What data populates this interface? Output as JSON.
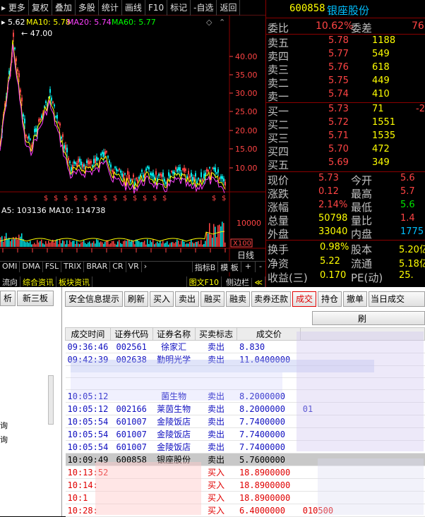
{
  "toolbar": {
    "items": [
      "更多",
      "复权",
      "叠加",
      "多股",
      "统计",
      "画线",
      "F10",
      "标记",
      "-自选",
      "返回"
    ]
  },
  "ma_line": {
    "ma5": "5.62",
    "ma10": "MA10: 5.78",
    "ma20": "MA20: 5.74",
    "ma60": "MA60: 5.77"
  },
  "price_axis": [
    "40.00",
    "35.00",
    "30.00",
    "25.00",
    "20.00",
    "15.00",
    "10.00"
  ],
  "peak_label": "47.00",
  "volume": {
    "label": "A5: 103136 MA10: 114738",
    "axis": "10000",
    "unit": "X100"
  },
  "period_label": "日线",
  "indicator_tabs": [
    "OMI",
    "DMA",
    "FSL",
    "TRIX",
    "BRAR",
    "CR",
    "VR"
  ],
  "indicator_right": [
    "指标B",
    "模 板",
    "+",
    "-"
  ],
  "nav_tabs": [
    "流向",
    "综合资讯",
    "板块资讯"
  ],
  "nav_right": [
    "图文F10",
    "侧边栏"
  ],
  "stock": {
    "code": "600858",
    "name": "银座股份",
    "webi_label": "委比",
    "webi_value": "10.62%",
    "weicha_label": "委差",
    "weicha_value": "76"
  },
  "asks": [
    {
      "label": "卖五",
      "price": "5.78",
      "vol": "1188"
    },
    {
      "label": "卖四",
      "price": "5.77",
      "vol": "549"
    },
    {
      "label": "卖三",
      "price": "5.76",
      "vol": "618"
    },
    {
      "label": "卖二",
      "price": "5.75",
      "vol": "449"
    },
    {
      "label": "卖一",
      "price": "5.74",
      "vol": "410"
    }
  ],
  "bids": [
    {
      "label": "买一",
      "price": "5.73",
      "vol": "71",
      "extra": "-2"
    },
    {
      "label": "买二",
      "price": "5.72",
      "vol": "1551",
      "extra": ""
    },
    {
      "label": "买三",
      "price": "5.71",
      "vol": "1535",
      "extra": ""
    },
    {
      "label": "买四",
      "price": "5.70",
      "vol": "472",
      "extra": ""
    },
    {
      "label": "买五",
      "price": "5.69",
      "vol": "349",
      "extra": ""
    }
  ],
  "stats": [
    {
      "l1": "现价",
      "v1": "5.73",
      "l2": "今开",
      "v2": "5.6"
    },
    {
      "l1": "涨跌",
      "v1": "0.12",
      "l2": "最高",
      "v2": "5.7"
    },
    {
      "l1": "涨幅",
      "v1": "2.14%",
      "l2": "最低",
      "v2": "5.6"
    },
    {
      "l1": "总量",
      "v1": "50798",
      "l2": "量比",
      "v2": "1.4"
    },
    {
      "l1": "外盘",
      "v1": "33040",
      "l2": "内盘",
      "v2": "1775"
    }
  ],
  "fund": [
    {
      "l1": "换手",
      "v1": "0.98%",
      "l2": "股本",
      "v2": "5.20亿"
    },
    {
      "l1": "净资",
      "v1": "5.22",
      "l2": "流通",
      "v2": "5.18亿"
    },
    {
      "l1": "收益(三)",
      "v1": "0.170",
      "l2": "PE(动)",
      "v2": "25."
    }
  ],
  "left_tabs": [
    "析",
    "新三板"
  ],
  "left_items": [
    "询",
    "询"
  ],
  "buttons": [
    "安全信息提示",
    "刷新",
    "买入",
    "卖出",
    "融买",
    "融卖",
    "卖券还款",
    "成交",
    "持仓",
    "撤单",
    "当日成交"
  ],
  "subbutton": "刷",
  "columns": [
    "成交时间",
    "证券代码",
    "证券名称",
    "买卖标志",
    "成交价"
  ],
  "rows": [
    {
      "time": "09:36:46",
      "code": "002561",
      "name": "徐家汇",
      "side": "卖出",
      "price": "8.830",
      "extra": "",
      "type": "sell"
    },
    {
      "time": "09:42:39",
      "code": "002638",
      "name": "勤明光学",
      "side": "卖出",
      "price": "11.0400000",
      "extra": "",
      "type": "sell"
    },
    {
      "time": "",
      "code": "",
      "name": "",
      "side": "",
      "price": "",
      "extra": "",
      "type": "blank"
    },
    {
      "time": "",
      "code": "",
      "name": "",
      "side": "",
      "price": "",
      "extra": "",
      "type": "blank"
    },
    {
      "time": "10:05:12",
      "code": "",
      "name": "菌生物",
      "side": "卖出",
      "price": "8.2000000",
      "extra": "",
      "type": "sell"
    },
    {
      "time": "10:05:12",
      "code": "002166",
      "name": "莱茵生物",
      "side": "卖出",
      "price": "8.2000000",
      "extra": "01",
      "type": "sell"
    },
    {
      "time": "10:05:54",
      "code": "601007",
      "name": "金陵饭店",
      "side": "卖出",
      "price": "7.7400000",
      "extra": "",
      "type": "sell"
    },
    {
      "time": "10:05:54",
      "code": "601007",
      "name": "金陵饭店",
      "side": "卖出",
      "price": "7.7400000",
      "extra": "",
      "type": "sell"
    },
    {
      "time": "10:05:54",
      "code": "601007",
      "name": "金陵饭店",
      "side": "卖出",
      "price": "7.7400000",
      "extra": "",
      "type": "sell"
    },
    {
      "time": "10:09:49",
      "code": "600858",
      "name": "银座股份",
      "side": "卖出",
      "price": "5.7600000",
      "extra": "",
      "type": "selected"
    },
    {
      "time": "10:13:52",
      "code": "",
      "name": "",
      "side": "买入",
      "price": "18.8900000",
      "extra": "",
      "type": "buy"
    },
    {
      "time": "10:14:",
      "code": "",
      "name": "",
      "side": "买入",
      "price": "18.8900000",
      "extra": "",
      "type": "buy"
    },
    {
      "time": "10:1",
      "code": "",
      "name": "",
      "side": "买入",
      "price": "18.8900000",
      "extra": "",
      "type": "buy"
    },
    {
      "time": "10:28:",
      "code": "",
      "name": "",
      "side": "买入",
      "price": "6.4000000",
      "extra": "010500",
      "type": "buy"
    }
  ],
  "colors": {
    "up": "#ff4444",
    "down": "#00e600",
    "accent": "#ffff00",
    "code": "#ffff00",
    "name": "#00c0ff"
  }
}
